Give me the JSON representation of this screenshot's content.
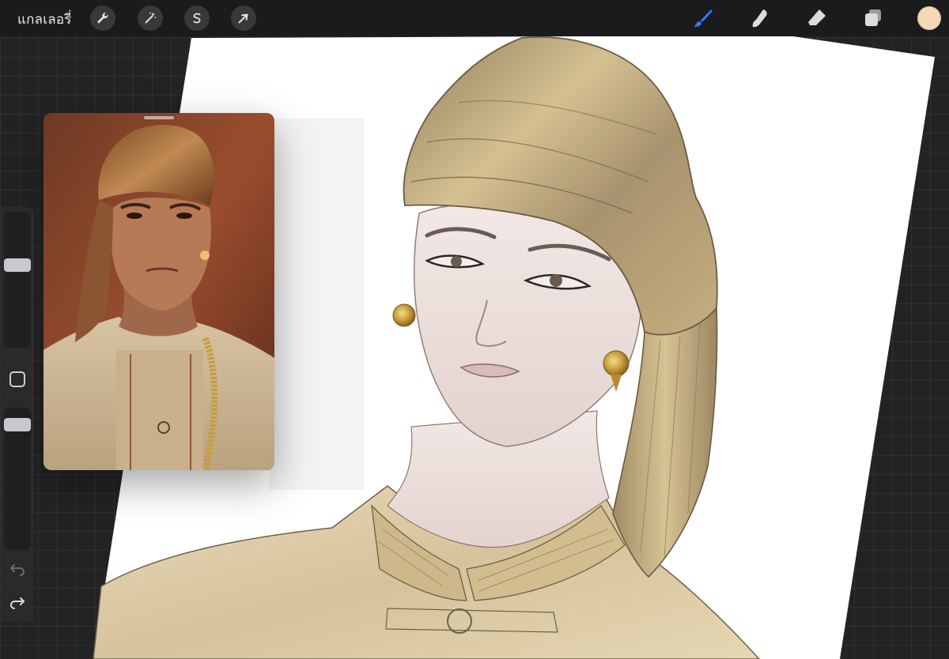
{
  "topbar": {
    "gallery_label": "แกลเลอรี่",
    "left_tools": [
      {
        "name": "actions",
        "icon": "wrench-icon"
      },
      {
        "name": "adjustments",
        "icon": "magic-wand-icon"
      },
      {
        "name": "selection",
        "icon": "selection-s-icon"
      },
      {
        "name": "transform",
        "icon": "arrow-cursor-icon"
      }
    ],
    "right_tools": [
      {
        "name": "brush",
        "icon": "brush-icon",
        "active": true
      },
      {
        "name": "smudge",
        "icon": "smudge-finger-icon"
      },
      {
        "name": "eraser",
        "icon": "eraser-icon"
      },
      {
        "name": "layers",
        "icon": "layers-icon"
      }
    ],
    "current_color": "#f3d9b4"
  },
  "sidebar": {
    "brush_size_level": 0.62,
    "opacity_level": 0.92,
    "modify_icon": "square-modify-icon",
    "undo_icon": "undo-arrow-icon",
    "redo_icon": "redo-arrow-icon"
  },
  "reference": {
    "handle_icon": "drag-handle-icon"
  },
  "colors": {
    "accent_blue": "#2e7cf6",
    "toolbar_bg": "#1b1b1d",
    "canvas_bg": "#ffffff",
    "turban_gold": "#c2a876",
    "skin": "#ece0dc"
  }
}
